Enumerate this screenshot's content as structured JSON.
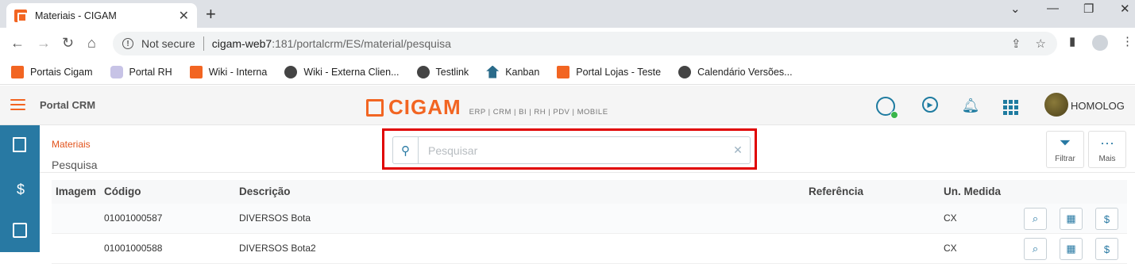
{
  "browser": {
    "tab_title": "Materiais - CIGAM",
    "not_secure_label": "Not secure",
    "url_host": "cigam-web7",
    "url_rest": ":181/portalcrm/ES/material/pesquisa",
    "bookmarks": [
      {
        "label": "Portais Cigam",
        "icon": "cigam-icon"
      },
      {
        "label": "Portal RH",
        "icon": "chat-icon"
      },
      {
        "label": "Wiki - Interna",
        "icon": "cigam-icon"
      },
      {
        "label": "Wiki - Externa Clien...",
        "icon": "globe-icon"
      },
      {
        "label": "Testlink",
        "icon": "globe-icon"
      },
      {
        "label": "Kanban",
        "icon": "kanban-icon"
      },
      {
        "label": "Portal Lojas - Teste",
        "icon": "cigam-icon"
      },
      {
        "label": "Calendário Versões...",
        "icon": "globe-icon"
      }
    ]
  },
  "header": {
    "portal_title": "Portal CRM",
    "logo_text": "CIGAM",
    "logo_subtitle": "ERP | CRM | BI | RH | PDV | MOBILE",
    "user_name": "HOMOLOG"
  },
  "breadcrumb": {
    "root": "Materiais",
    "page": "Pesquisa"
  },
  "search": {
    "placeholder": "Pesquisar",
    "value": ""
  },
  "actions": {
    "filter_label": "Filtrar",
    "more_label": "Mais"
  },
  "table": {
    "columns": [
      "Imagem",
      "Código",
      "Descrição",
      "Referência",
      "Un. Medida"
    ],
    "rows": [
      {
        "codigo": "01001000587",
        "descricao": "DIVERSOS Bota",
        "referencia": "",
        "unidade": "CX"
      },
      {
        "codigo": "01001000588",
        "descricao": "DIVERSOS Bota2",
        "referencia": "",
        "unidade": "CX"
      }
    ]
  },
  "colors": {
    "brand_orange": "#f26522",
    "sidebar_blue": "#2879a3",
    "highlight_red": "#e00000",
    "online_green": "#39b54a"
  }
}
